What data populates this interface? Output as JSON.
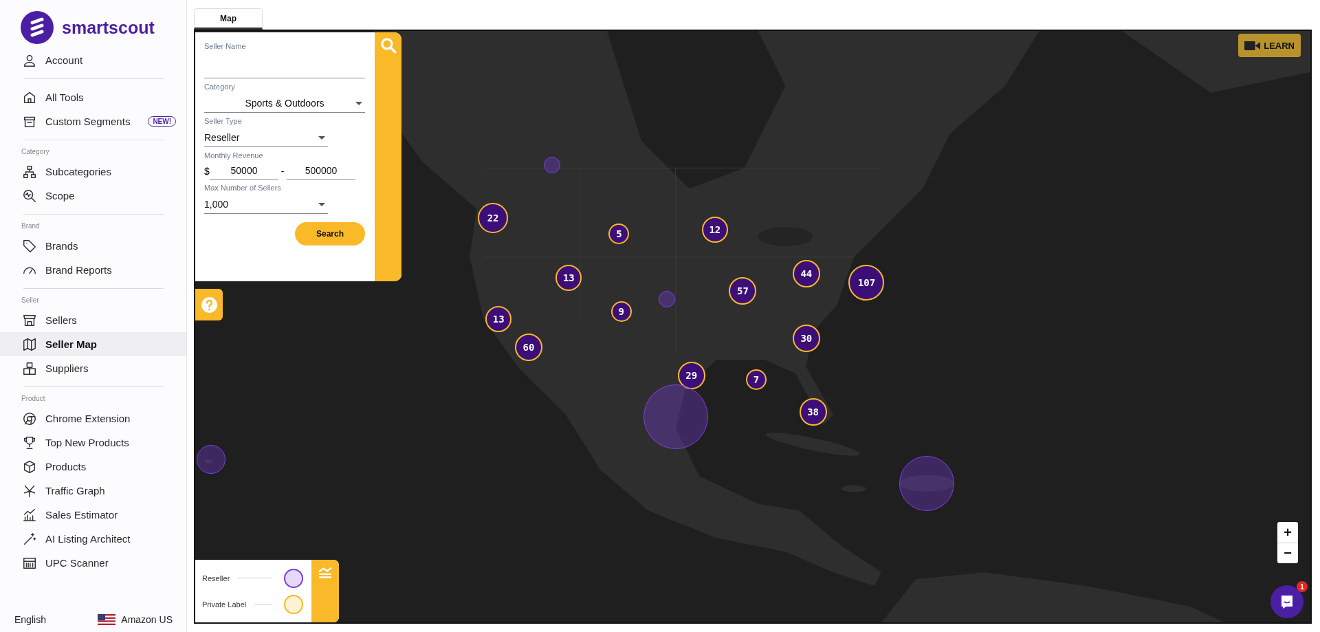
{
  "sidebar": {
    "logo": "smartscout",
    "account": {
      "label": "Account",
      "selected": false
    },
    "sections": [
      {
        "items": [
          {
            "label": "All Tools",
            "selected": false
          },
          {
            "label": "Custom Segments",
            "selected": false,
            "badge": "NEW!"
          }
        ]
      },
      {
        "heading": "Category",
        "items": [
          {
            "label": "Subcategories",
            "selected": false
          },
          {
            "label": "Scope",
            "selected": false
          }
        ]
      },
      {
        "heading": "Brand",
        "items": [
          {
            "label": "Brands",
            "selected": false
          },
          {
            "label": "Brand Reports",
            "selected": false
          }
        ]
      },
      {
        "heading": "Seller",
        "items": [
          {
            "label": "Sellers",
            "selected": false
          },
          {
            "label": "Seller Map",
            "selected": true
          },
          {
            "label": "Suppliers",
            "selected": false
          }
        ]
      },
      {
        "heading": "Product",
        "items": [
          {
            "label": "Chrome Extension",
            "selected": false
          },
          {
            "label": "Top New Products",
            "selected": false
          },
          {
            "label": "Products",
            "selected": false
          },
          {
            "label": "Traffic Graph",
            "selected": false
          },
          {
            "label": "Sales Estimator",
            "selected": false
          },
          {
            "label": "AI Listing Architect",
            "selected": false
          },
          {
            "label": "UPC Scanner",
            "selected": false
          }
        ]
      }
    ],
    "footer": {
      "language": "English",
      "marketplace": "Amazon US"
    }
  },
  "tabs": [
    {
      "label": "Map",
      "selected": true
    }
  ],
  "filters": {
    "seller_name": {
      "label": "Seller Name"
    },
    "category": {
      "label": "Category",
      "value": "Sports & Outdoors"
    },
    "seller_type": {
      "label": "Seller Type",
      "value": "Reseller"
    },
    "monthly_revenue": {
      "label": "Monthly Revenue",
      "currency": "$",
      "min": "50000",
      "separator": "-",
      "max": "500000"
    },
    "max_sellers": {
      "label": "Max Number of Sellers",
      "value": "1,000"
    },
    "button": "Search"
  },
  "learn_button": "LEARN",
  "zoom": {
    "in": "+",
    "out": "−"
  },
  "markers": [
    {
      "kind": "cluster",
      "count": "22"
    },
    {
      "kind": "cluster",
      "count": "5"
    },
    {
      "kind": "cluster",
      "count": "12"
    },
    {
      "kind": "cluster",
      "count": "13"
    },
    {
      "kind": "cluster",
      "count": "44"
    },
    {
      "kind": "cluster",
      "count": "107"
    },
    {
      "kind": "cluster",
      "count": "57"
    },
    {
      "kind": "cluster",
      "count": "9"
    },
    {
      "kind": "cluster",
      "count": "13"
    },
    {
      "kind": "cluster",
      "count": "60"
    },
    {
      "kind": "cluster",
      "count": "30"
    },
    {
      "kind": "cluster",
      "count": "29"
    },
    {
      "kind": "cluster",
      "count": "7"
    },
    {
      "kind": "cluster",
      "count": "38"
    },
    {
      "kind": "single"
    },
    {
      "kind": "single"
    },
    {
      "kind": "single"
    },
    {
      "kind": "single"
    },
    {
      "kind": "single"
    }
  ],
  "legend": [
    {
      "label": "Reseller",
      "color": "#7b3fe4"
    },
    {
      "label": "Private Label",
      "color": "#f9b928"
    }
  ],
  "chat": {
    "badge": "1"
  }
}
